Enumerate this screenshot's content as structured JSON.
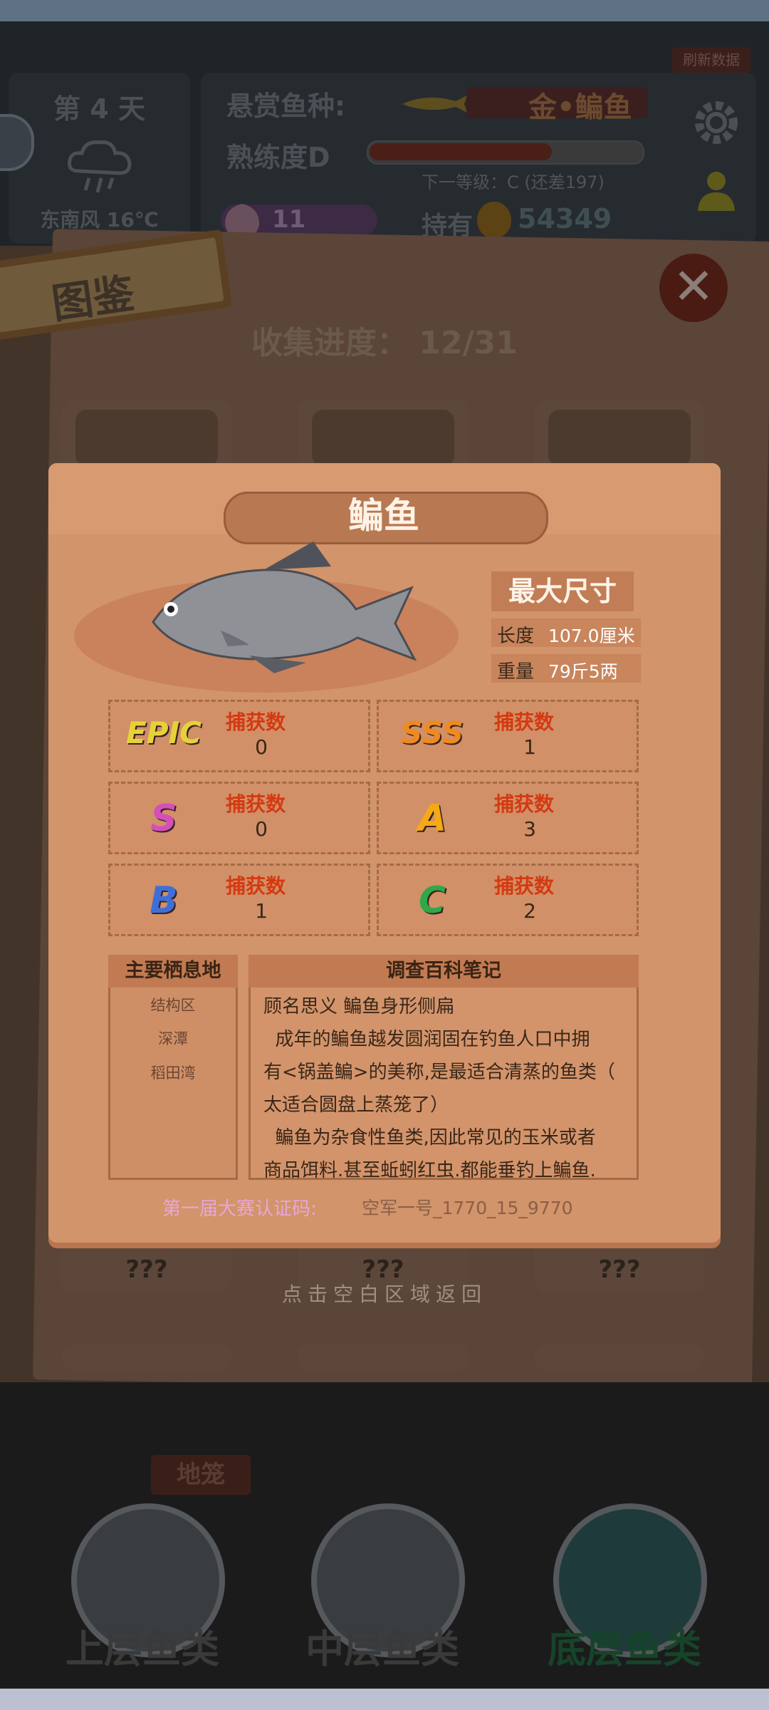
{
  "hud": {
    "refresh_label": "刷新数据",
    "day": "第 4 天",
    "weather": "东南风 16℃",
    "bounty_label": "悬赏鱼种:",
    "bounty_fish": "金•鳊鱼",
    "mastery": "熟练度D",
    "mastery_progress": 0.67,
    "next_level": "下一等级：C (还差197)",
    "gems": "11",
    "holding_label": "持有",
    "coins": "54349"
  },
  "album": {
    "tag": "图鉴",
    "progress": "收集进度： 12/31",
    "unknown": "???",
    "back_hint": "点击空白区域返回"
  },
  "card": {
    "fish_name": "鳊鱼",
    "max_size_title": "最大尺寸",
    "length_label": "长度",
    "length_value": "107.0厘米",
    "weight_label": "重量",
    "weight_value": "79斤5两",
    "catch_label": "捕获数",
    "grades": [
      {
        "grade": "EPIC",
        "count": "0",
        "color": "#e5d23a"
      },
      {
        "grade": "SSS",
        "count": "1",
        "color": "#f08a1c"
      },
      {
        "grade": "S",
        "count": "0",
        "color": "#d44fb8"
      },
      {
        "grade": "A",
        "count": "3",
        "color": "#f5a915"
      },
      {
        "grade": "B",
        "count": "1",
        "color": "#3f6fd6"
      },
      {
        "grade": "C",
        "count": "2",
        "color": "#2ea84a"
      }
    ],
    "habitat_title": "主要栖息地",
    "habitats": [
      "结构区",
      "深潭",
      "稻田湾"
    ],
    "notes_title": "调查百科笔记",
    "notes": [
      "顾名思义 鳊鱼身形侧扁",
      "  成年的鳊鱼越发圆润固在钓鱼人口中拥",
      "有<锅盖鳊>的美称,是最适合清蒸的鱼类（",
      "太适合圆盘上蒸笼了）",
      "  鳊鱼为杂食性鱼类,因此常见的玉米或者",
      "商品饵料.甚至蚯蚓红虫.都能垂钓上鳊鱼."
    ],
    "cert_label": "第一届大赛认证码:",
    "cert_value": "空军一号_1770_15_9770"
  },
  "bottom": {
    "cage_label": "地笼",
    "tabs": [
      "上层鱼类",
      "中层鱼类",
      "底层鱼类"
    ]
  }
}
